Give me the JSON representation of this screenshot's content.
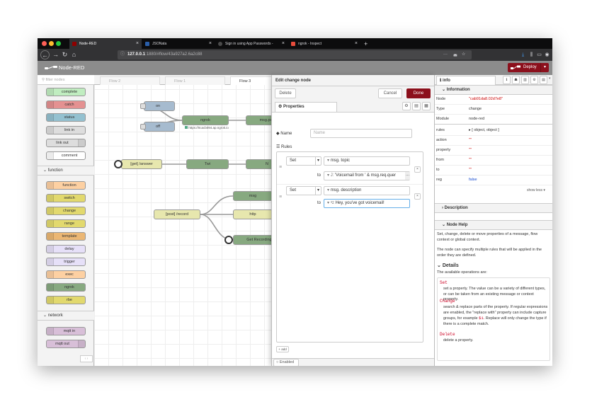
{
  "browser": {
    "tabs": [
      {
        "title": "Node-RED",
        "icon_color": "#8f0000"
      },
      {
        "title": "JSONata",
        "icon_color": "#2a5ea8"
      },
      {
        "title": "Sign in using App Passwords - ",
        "icon_color": "#4a4a4a"
      },
      {
        "title": "ngrok - Inspect",
        "icon_color": "#e74c3c"
      }
    ],
    "new_tab": "+",
    "url": "127.0.0.1:1880/#flow/43a927a2.6a2c88",
    "url_host": "127.0.0.1",
    "url_rest": ":1880/#flow/43a927a2.6a2c88",
    "toolbar_more": "···",
    "nav": {
      "back": "←",
      "forward": "→",
      "reload": "↻",
      "home": "⌂"
    }
  },
  "app": {
    "title": "Node-RED",
    "deploy_label": "Deploy",
    "deploy_color": "#8c101c"
  },
  "palette": {
    "filter_placeholder": "filter nodes",
    "nodes_top": [
      {
        "label": "complete",
        "color": "#c0edc0"
      },
      {
        "label": "catch",
        "color": "#e49191"
      },
      {
        "label": "status",
        "color": "#94c1d0"
      },
      {
        "label": "link in",
        "color": "#dddddd"
      },
      {
        "label": "link out",
        "color": "#dddddd"
      },
      {
        "label": "comment",
        "color": "#ffffff"
      }
    ],
    "category_function": "function",
    "nodes_function": [
      {
        "label": "function",
        "color": "#fdd0a2"
      },
      {
        "label": "switch",
        "color": "#e2d96e"
      },
      {
        "label": "change",
        "color": "#e2d96e"
      },
      {
        "label": "range",
        "color": "#e2d96e"
      },
      {
        "label": "template",
        "color": "#ebb774"
      },
      {
        "label": "delay",
        "color": "#e6e0f8"
      },
      {
        "label": "trigger",
        "color": "#e6e0f8"
      },
      {
        "label": "exec",
        "color": "#fdd0a2"
      },
      {
        "label": "ngrok",
        "color": "#87a980"
      },
      {
        "label": "rbe",
        "color": "#e2d96e"
      }
    ],
    "category_network": "network",
    "nodes_network": [
      {
        "label": "mqtt in",
        "color": "#d8bfd8"
      },
      {
        "label": "mqtt out",
        "color": "#d8bfd8"
      }
    ]
  },
  "workspace": {
    "tabs": [
      "Flow 2",
      "Flow 1",
      "Flow 3"
    ],
    "nodes": {
      "on": "on",
      "off": "off",
      "ngrok": "ngrok",
      "ngrok_status": "https://0cacb094.ap.ngrok.io",
      "msg_payload": "msg.pay",
      "get_answer": "[get] /answer",
      "twiml": "Twi",
      "post_record": "[post] /record",
      "msg": "msg",
      "http": "http",
      "get_recording": "Get Recording"
    }
  },
  "editor": {
    "title": "Edit change node",
    "delete_label": "Delete",
    "cancel_label": "Cancel",
    "done_label": "Done",
    "properties_tab": "Properties",
    "name_label": "Name",
    "name_placeholder": "Name",
    "rules_label": "Rules",
    "rules": [
      {
        "action": "Set",
        "target_prefix": "msg.",
        "target": "topic",
        "to": "to",
        "value": "'Voicemail from ' & msg.req.quer"
      },
      {
        "action": "Set",
        "target_prefix": "msg.",
        "target": "description",
        "to": "to",
        "value": "Hey, you've got voicemail!"
      }
    ],
    "add_label": "add",
    "enabled_label": "Enabled"
  },
  "sidebar": {
    "tab_label": "info",
    "information_header": "Information",
    "rows": [
      {
        "k": "Node",
        "v": "\"cab91da8.02d7e8\""
      },
      {
        "k": "Type",
        "v": "change"
      },
      {
        "k": "Module",
        "v": "node-red"
      },
      {
        "k": "rules",
        "v": "[ object, object ]"
      },
      {
        "k": "action",
        "v": "\"\""
      },
      {
        "k": "property",
        "v": "\"\""
      },
      {
        "k": "from",
        "v": "\"\""
      },
      {
        "k": "to",
        "v": "\"\""
      },
      {
        "k": "reg",
        "v": "false"
      }
    ],
    "show_less": "show less",
    "description_header": "Description",
    "node_help_header": "Node Help",
    "help_p1": "Set, change, delete or move properties of a message, flow context or global context.",
    "help_p2": "The node can specify multiple rules that will be applied in the order they are defined.",
    "details_header": "Details",
    "details_intro": "The available operations are:",
    "op_set": "Set",
    "op_set_desc": "set a property. The value can be a variety of different types, or can be taken from an existing message or context property.",
    "op_change": "Change",
    "op_change_desc_1": "search & replace parts of the property. If regular expressions are enabled, the \"replace with\" property can include capture groups, for example",
    "op_change_code": "$1",
    "op_change_desc_2": ". Replace will only change the type if there is a complete match.",
    "op_delete": "Delete",
    "op_delete_desc": "delete a property."
  }
}
